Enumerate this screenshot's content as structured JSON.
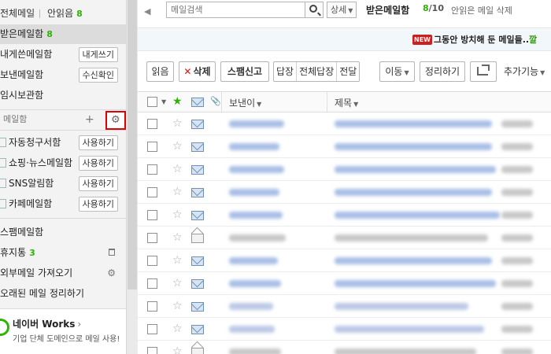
{
  "sidebar": {
    "all_mail": "전체메일",
    "unread": "안읽음",
    "unread_count": "8",
    "inbox": "받은메일함",
    "inbox_count": "8",
    "sent": "내게쓴메일함",
    "sent_btn": "내게쓰기",
    "sent_mail": "보낸메일함",
    "receipt_btn": "수신확인",
    "temp": "임시보관함",
    "folder_header": "메일함",
    "folders": [
      {
        "label": "자동청구서함",
        "action": "사용하기"
      },
      {
        "label": "쇼핑·뉴스메일함",
        "action": "사용하기"
      },
      {
        "label": "SNS알림함",
        "action": "사용하기"
      },
      {
        "label": "카페메일함",
        "action": "사용하기"
      }
    ],
    "spam": "스팸메일함",
    "trash": "휴지통",
    "trash_count": "3",
    "external": "외부메일 가져오기",
    "cleanup": "오래된 메일 정리하기",
    "works_title": "네이버 Works",
    "works_sub": "기업 단체 도메인으로 메일 사용!"
  },
  "topbar": {
    "search_placeholder": "메일검색",
    "detail": "상세",
    "inbox_title": "받은메일함",
    "count_unread": "8",
    "count_total": "/10",
    "unread_delete": "안읽은 메일 삭제"
  },
  "notice": {
    "badge": "NEW",
    "text": "그동안 방치해 둔 메일들..",
    "highlight": "깔"
  },
  "toolbar": {
    "read": "읽음",
    "delete": "삭제",
    "spam": "스팸신고",
    "reply": "답장",
    "reply_all": "전체답장",
    "forward": "전달",
    "move": "이동",
    "organize": "정리하기",
    "more": "추가기능"
  },
  "list": {
    "sender_header": "보낸이",
    "subject_header": "제목",
    "rows": [
      {
        "open": false
      },
      {
        "open": false
      },
      {
        "open": false
      },
      {
        "open": false
      },
      {
        "open": false
      },
      {
        "open": true
      },
      {
        "open": false
      },
      {
        "open": false
      },
      {
        "open": false
      },
      {
        "open": false
      },
      {
        "open": true
      }
    ]
  }
}
